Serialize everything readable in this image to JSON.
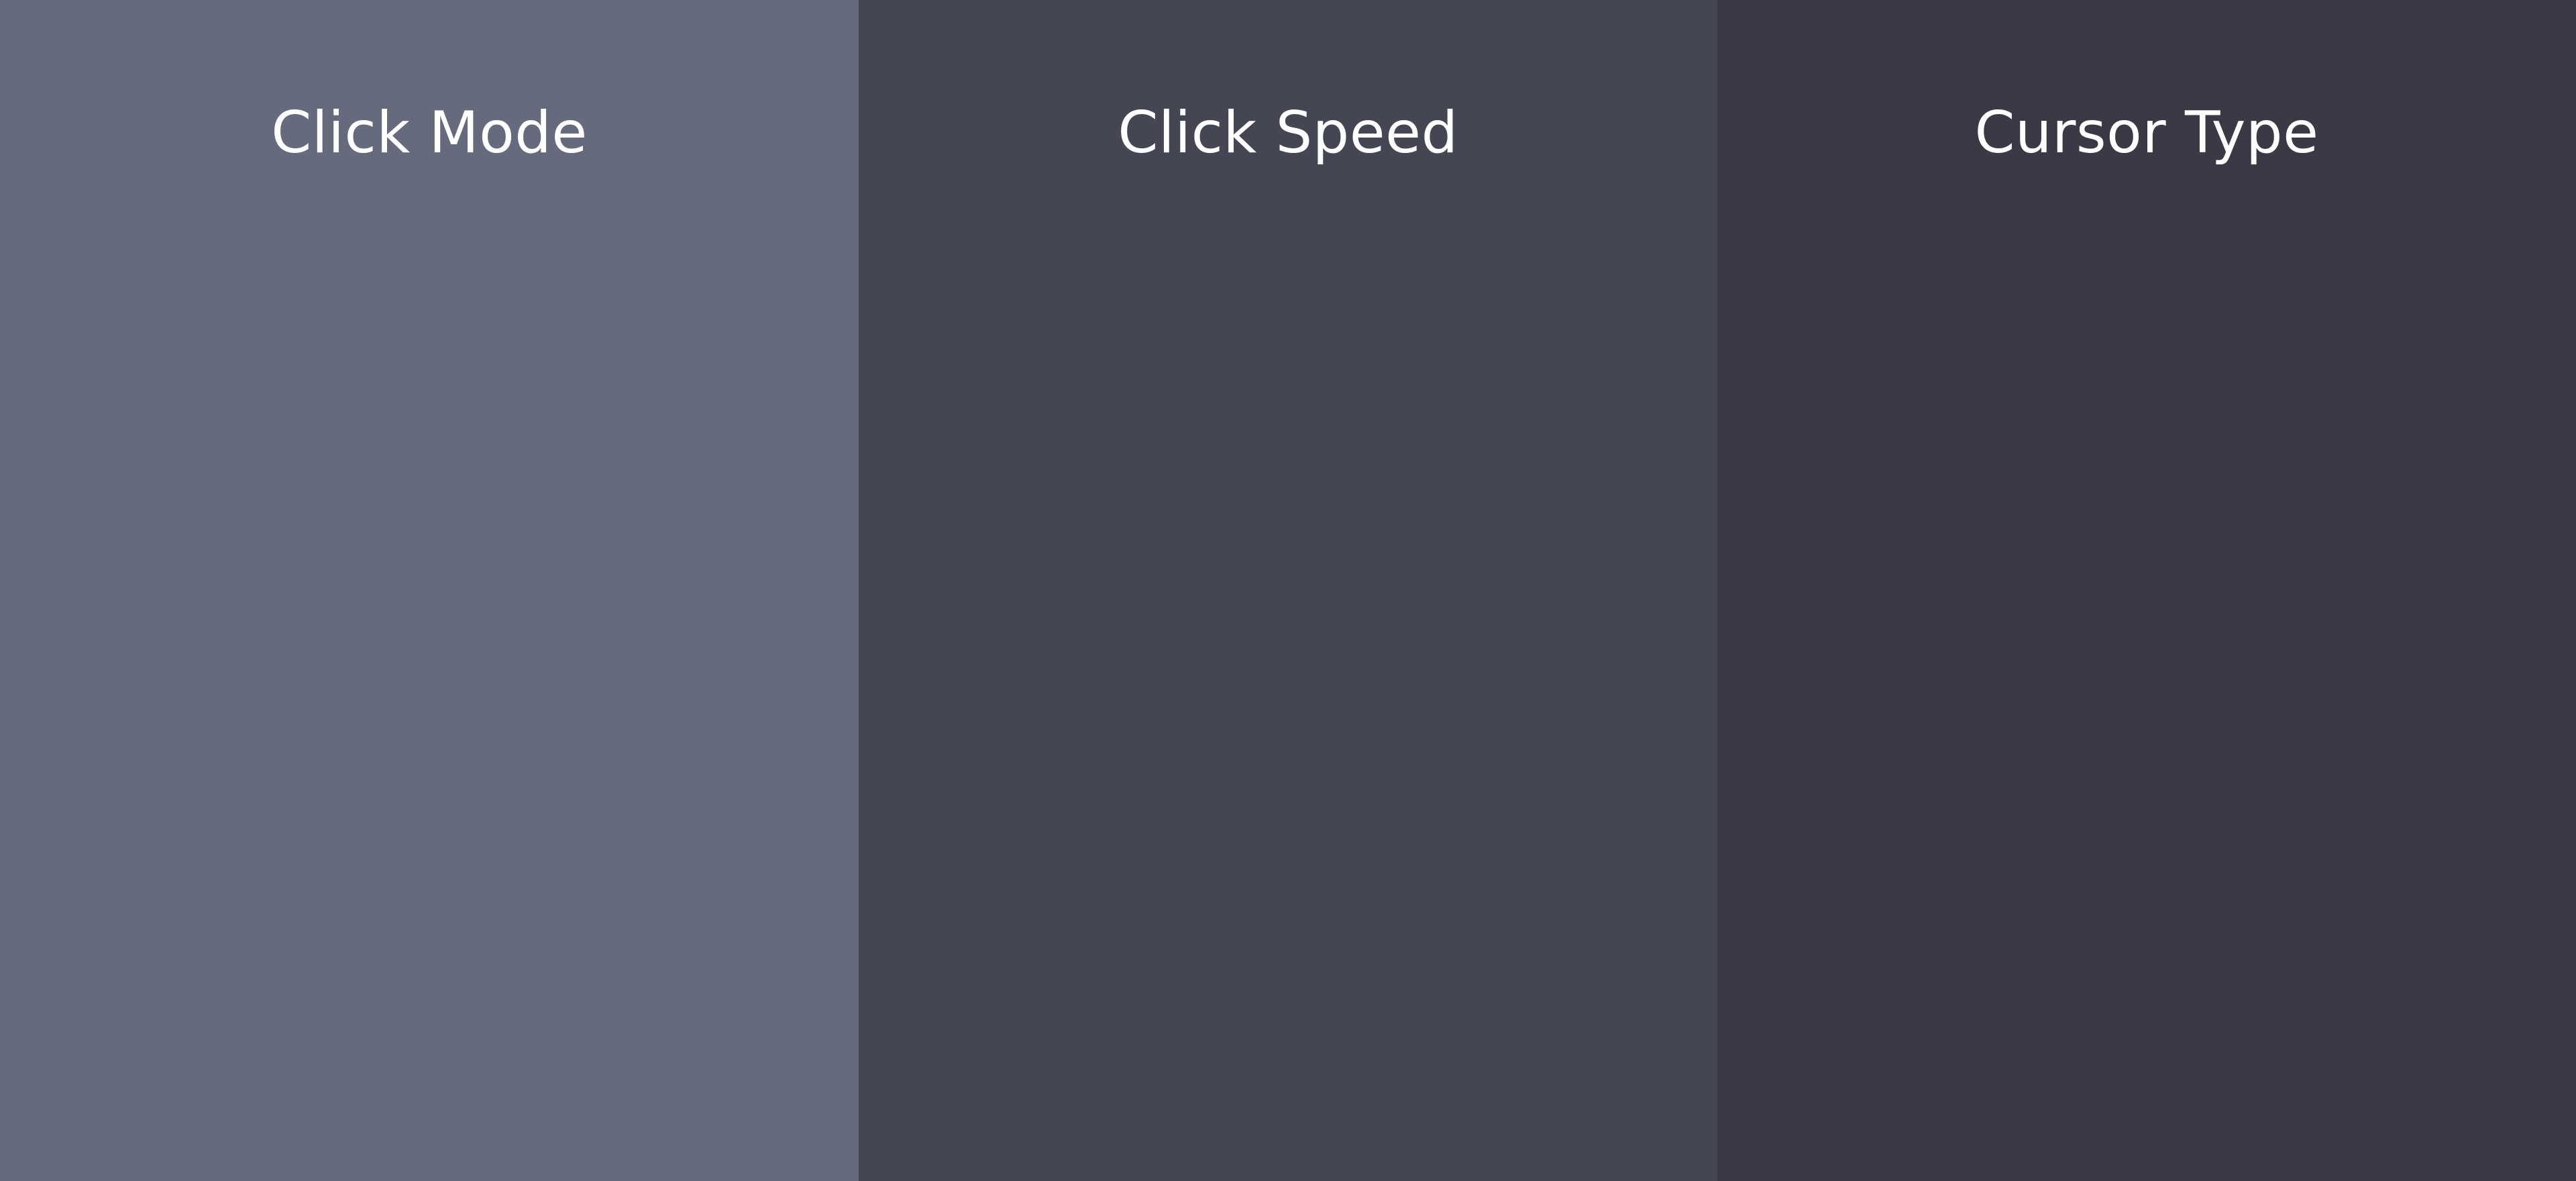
{
  "panels": [
    {
      "title": "Click Mode",
      "color": "#656a7c"
    },
    {
      "title": "Click Speed",
      "color": "#454653"
    },
    {
      "title": "Cursor Type",
      "color": "#393a46"
    }
  ]
}
